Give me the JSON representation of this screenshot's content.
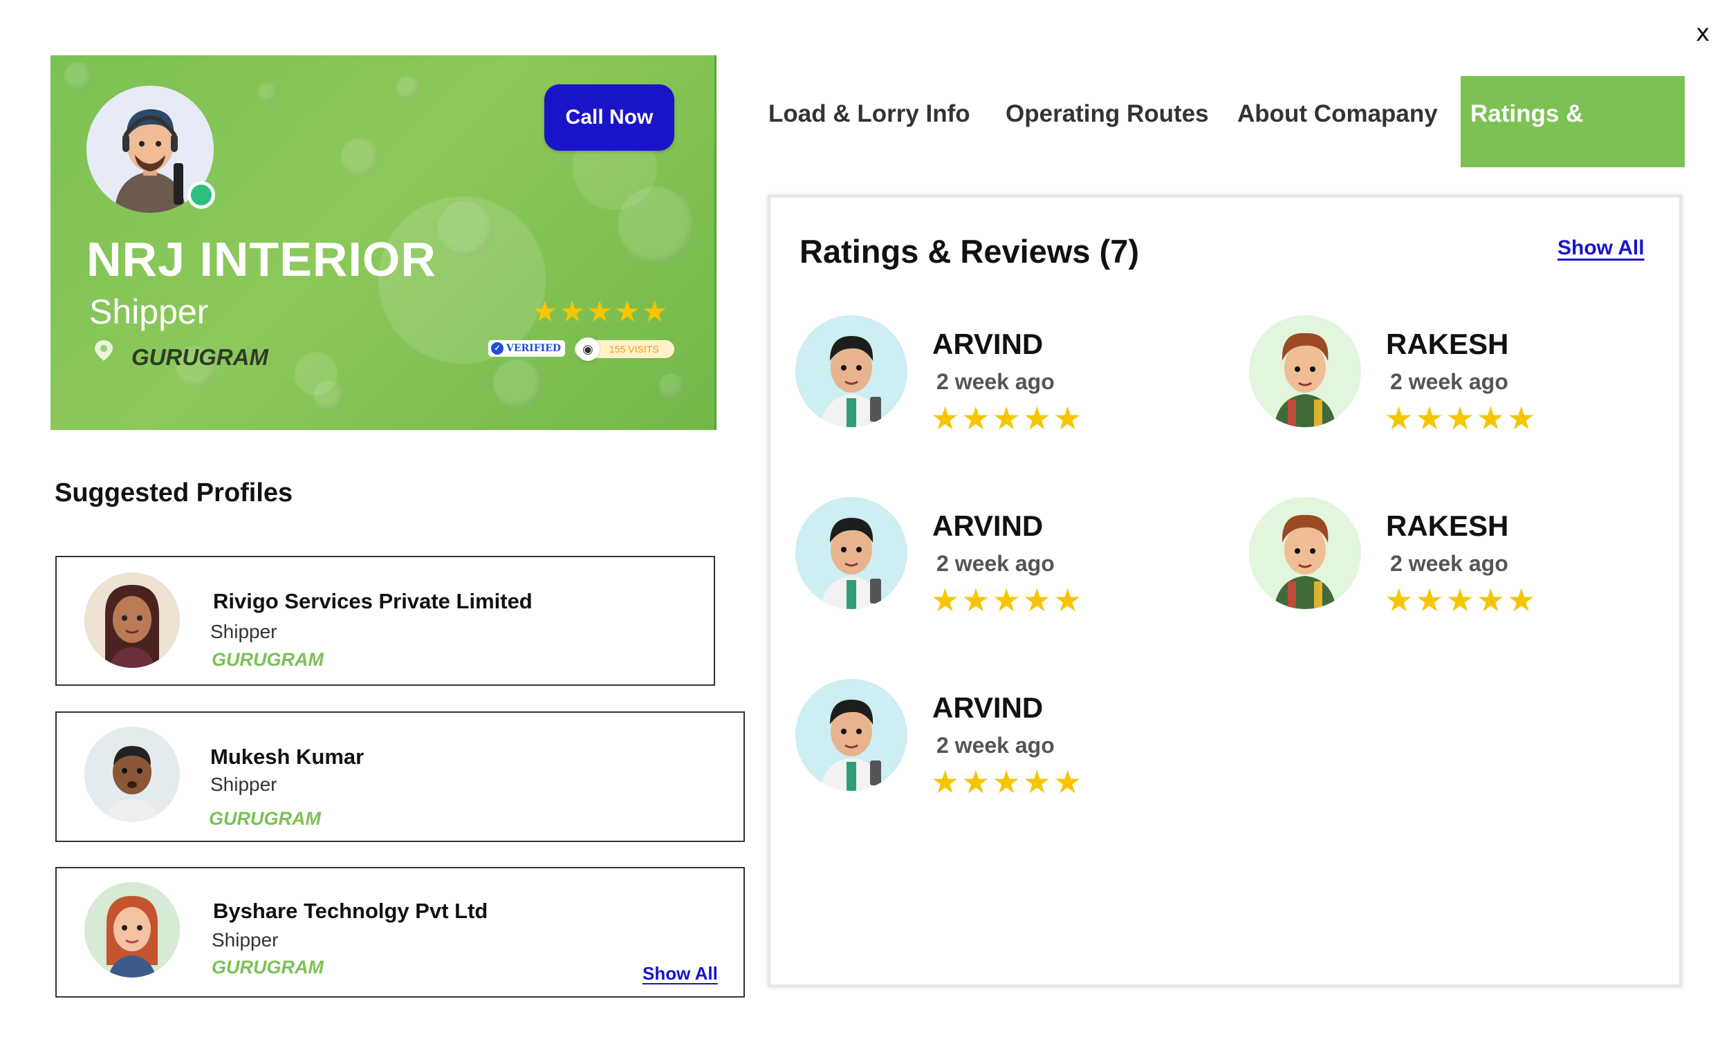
{
  "close_label": "x",
  "profile": {
    "name": "NRJ INTERIOR",
    "role": "Shipper",
    "city": "GURUGRAM",
    "call_label": "Call Now",
    "stars": "★★★★★",
    "verified_label": "VERIFIED",
    "visits_label": "155 VISITS",
    "status": "online"
  },
  "suggested": {
    "title": "Suggested Profiles",
    "show_all": "Show All",
    "items": [
      {
        "name": "Rivigo Services Private Limited",
        "role": "Shipper",
        "city": "GURUGRAM"
      },
      {
        "name": "Mukesh Kumar",
        "role": "Shipper",
        "city": "GURUGRAM"
      },
      {
        "name": "Byshare Technolgy Pvt Ltd",
        "role": "Shipper",
        "city": "GURUGRAM"
      }
    ]
  },
  "tabs": [
    {
      "label": "Load & Lorry Info",
      "active": false
    },
    {
      "label": "Operating Routes",
      "active": false
    },
    {
      "label": "About Comapany",
      "active": false
    },
    {
      "label": "Ratings & Reviews",
      "active": true
    }
  ],
  "reviews": {
    "title": "Ratings & Reviews (7)",
    "show_all": "Show All",
    "items": [
      {
        "name": "ARVIND",
        "time": "2 week ago",
        "stars": "★★★★★",
        "rating": 5
      },
      {
        "name": "RAKESH",
        "time": "2 week ago",
        "stars": "★★★★★",
        "rating": 5
      },
      {
        "name": "ARVIND",
        "time": "2 week ago",
        "stars": "★★★★★",
        "rating": 5
      },
      {
        "name": "RAKESH",
        "time": "2 week ago",
        "stars": "★★★★★",
        "rating": 5
      },
      {
        "name": "ARVIND",
        "time": "2 week ago",
        "stars": "★★★★★",
        "rating": 5
      }
    ]
  },
  "colors": {
    "brand_green": "#7cc153",
    "call_blue": "#1a14c8",
    "star_yellow": "#f7c500",
    "online_green": "#2dbf7f"
  }
}
